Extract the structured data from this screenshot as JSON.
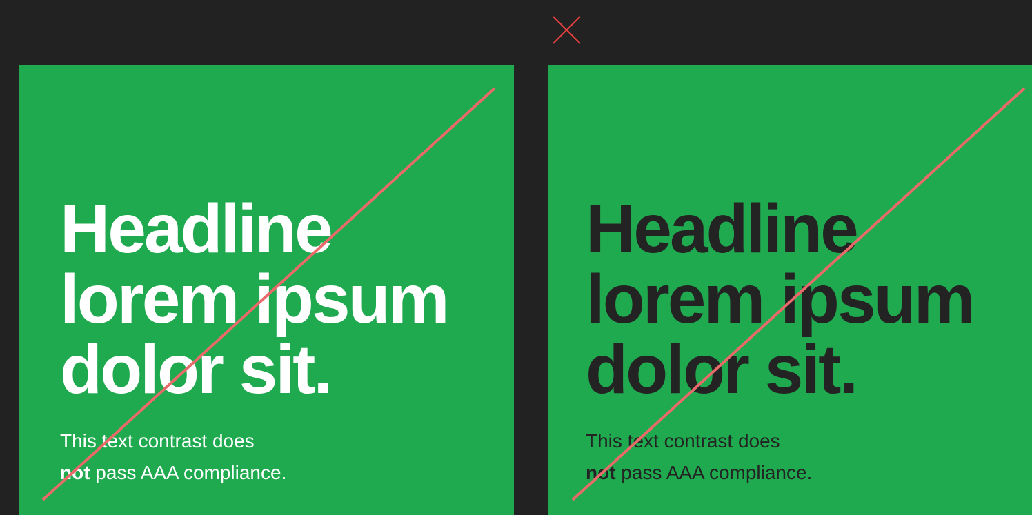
{
  "colors": {
    "background": "#222222",
    "card_green": "#20AA4F",
    "light_text": "#FFFFFF",
    "dark_text": "#232323",
    "strike_red": "#E86A6A",
    "top_x_red": "#E0403F"
  },
  "top_icon": "close-x-icon",
  "cards": [
    {
      "headline": [
        "Headline",
        "lorem ipsum",
        "dolor sit."
      ],
      "body_line1": "This text contrast does",
      "body_bold": "not",
      "body_rest": " pass AAA compliance."
    },
    {
      "headline": [
        "Headline",
        "lorem ipsum",
        "dolor sit."
      ],
      "body_line1": "This text contrast does",
      "body_bold": "not",
      "body_rest": " pass AAA compliance."
    }
  ]
}
